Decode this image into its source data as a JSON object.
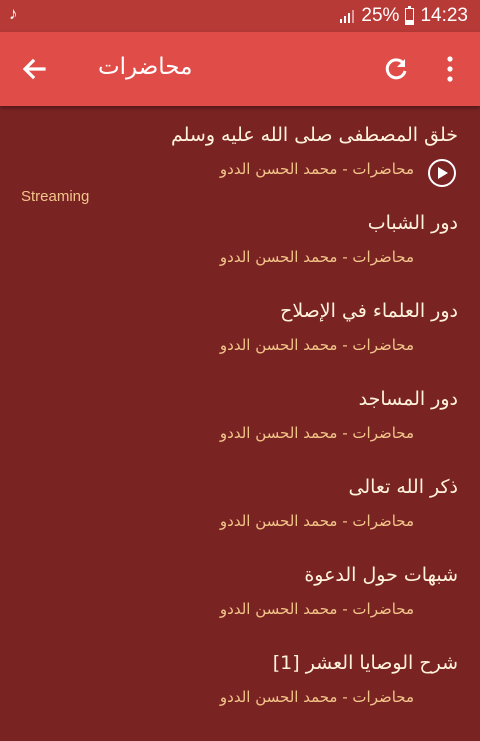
{
  "status_bar": {
    "battery_percent": "25%",
    "battery_level": 0.25,
    "time": "14:23",
    "icons": [
      "music-note-icon",
      "signal-icon",
      "battery-icon"
    ]
  },
  "app_bar": {
    "title": "محاضرات",
    "icons": [
      "back-arrow-icon",
      "refresh-icon",
      "more-vert-icon"
    ],
    "color": "#e04d48"
  },
  "colors": {
    "background": "#7a2323",
    "status_bar": "#b83a37",
    "title_text": "#fff3dc",
    "subtitle_text": "#f2c68a"
  },
  "items": [
    {
      "title": "خلق المصطفى صلى الله عليه وسلم",
      "subtitle": "محاضرات - محمد الحسن الددو",
      "status": "Streaming"
    },
    {
      "title": "دور الشباب",
      "subtitle": "محاضرات - محمد الحسن الددو"
    },
    {
      "title": "دور العلماء في الإصلاح",
      "subtitle": "محاضرات - محمد الحسن الددو"
    },
    {
      "title": "دور المساجد",
      "subtitle": "محاضرات - محمد الحسن الددو"
    },
    {
      "title": "ذكر الله تعالى",
      "subtitle": "محاضرات - محمد الحسن الددو"
    },
    {
      "title": "شبهات حول الدعوة",
      "subtitle": "محاضرات - محمد الحسن الددو"
    },
    {
      "title": "شرح الوصايا العشر [1]",
      "subtitle": "محاضرات - محمد الحسن الددو"
    }
  ]
}
